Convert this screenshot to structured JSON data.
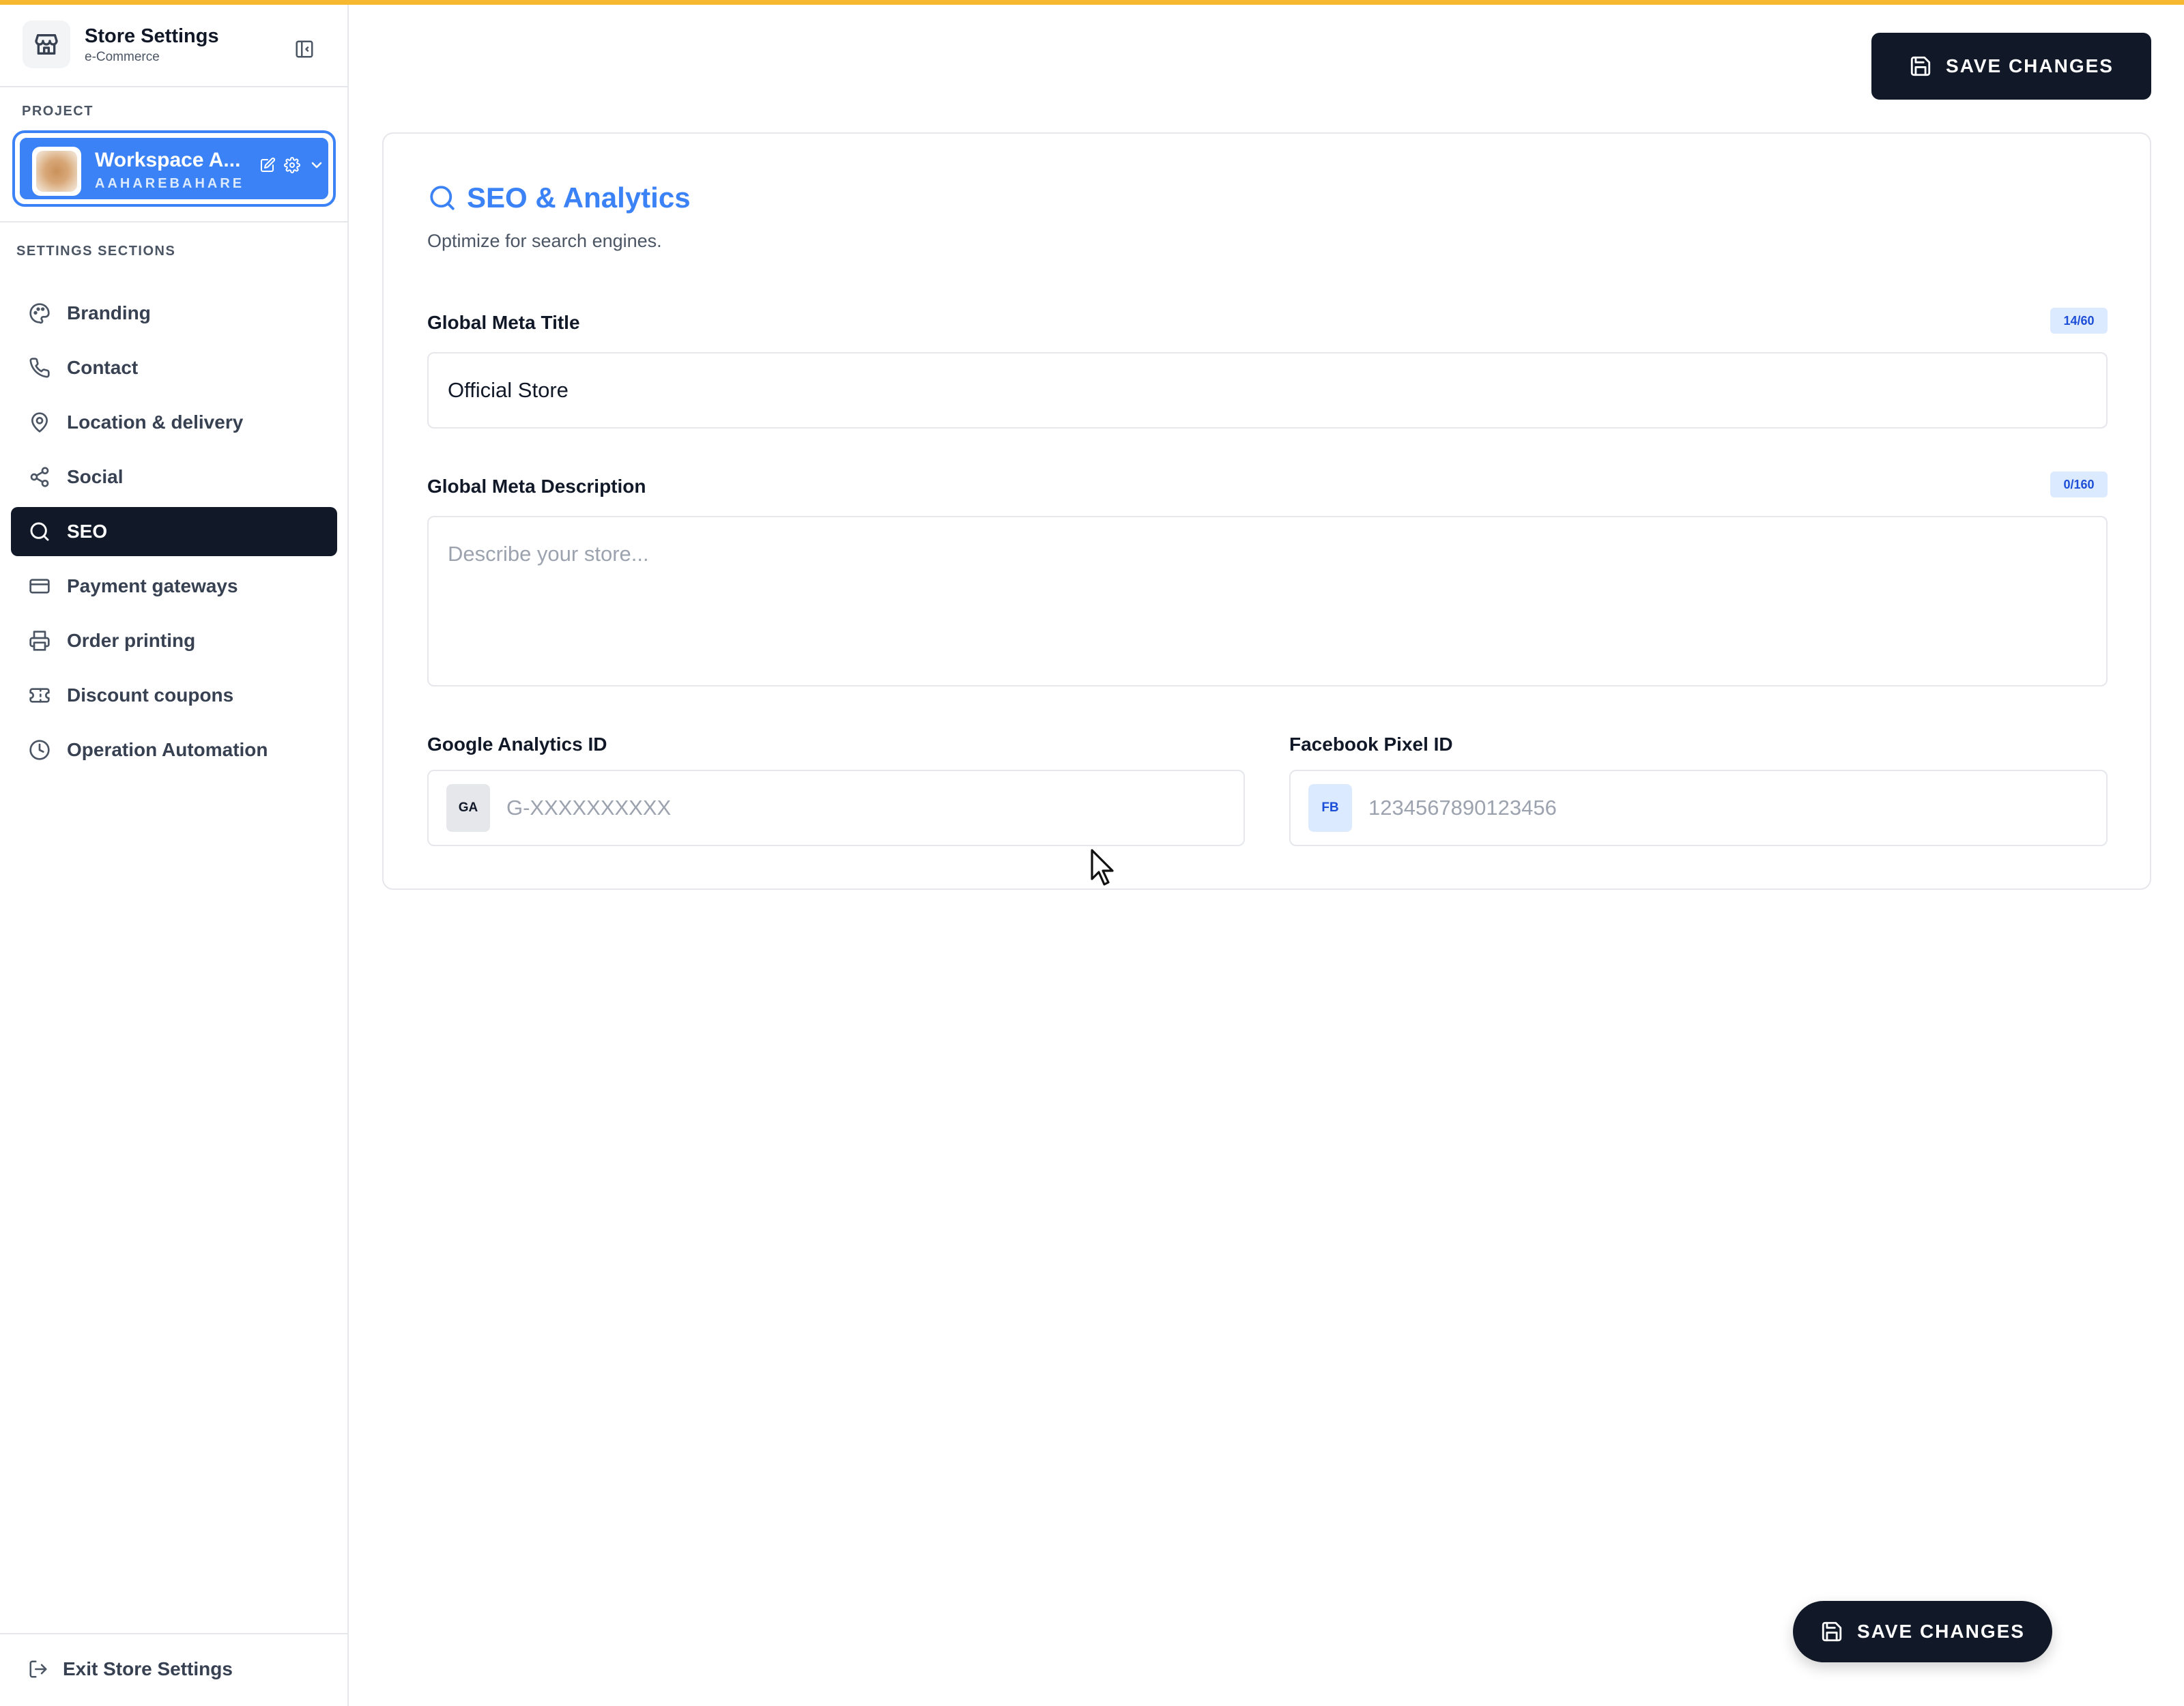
{
  "sidebar": {
    "store_title": "Store Settings",
    "store_subtitle": "e-Commerce",
    "project_label": "PROJECT",
    "project_name": "Workspace A...",
    "project_slug": "AAHAREBAHARE",
    "sections_label": "SETTINGS SECTIONS",
    "items": [
      {
        "label": "Branding",
        "icon": "palette-icon"
      },
      {
        "label": "Contact",
        "icon": "phone-icon"
      },
      {
        "label": "Location & delivery",
        "icon": "map-pin-icon"
      },
      {
        "label": "Social",
        "icon": "share-icon"
      },
      {
        "label": "SEO",
        "icon": "search-icon",
        "active": true
      },
      {
        "label": "Payment gateways",
        "icon": "credit-card-icon"
      },
      {
        "label": "Order printing",
        "icon": "printer-icon"
      },
      {
        "label": "Discount coupons",
        "icon": "ticket-icon"
      },
      {
        "label": "Operation Automation",
        "icon": "clock-icon"
      }
    ],
    "exit_label": "Exit Store Settings"
  },
  "toolbar": {
    "save_label": "SAVE CHANGES"
  },
  "seo": {
    "title": "SEO & Analytics",
    "subtitle": "Optimize for search engines.",
    "meta_title_label": "Global Meta Title",
    "meta_title_counter": "14/60",
    "meta_title_value": "Official Store",
    "meta_desc_label": "Global Meta Description",
    "meta_desc_counter": "0/160",
    "meta_desc_placeholder": "Describe your store...",
    "ga_label": "Google Analytics ID",
    "ga_prefix": "GA",
    "ga_placeholder": "G-XXXXXXXXXX",
    "fb_label": "Facebook Pixel ID",
    "fb_prefix": "FB",
    "fb_placeholder": "1234567890123456"
  },
  "floating": {
    "save_label": "SAVE CHANGES"
  },
  "colors": {
    "accent": "#3b82f6",
    "dark": "#111827",
    "top_bar": "#f5b82e"
  }
}
